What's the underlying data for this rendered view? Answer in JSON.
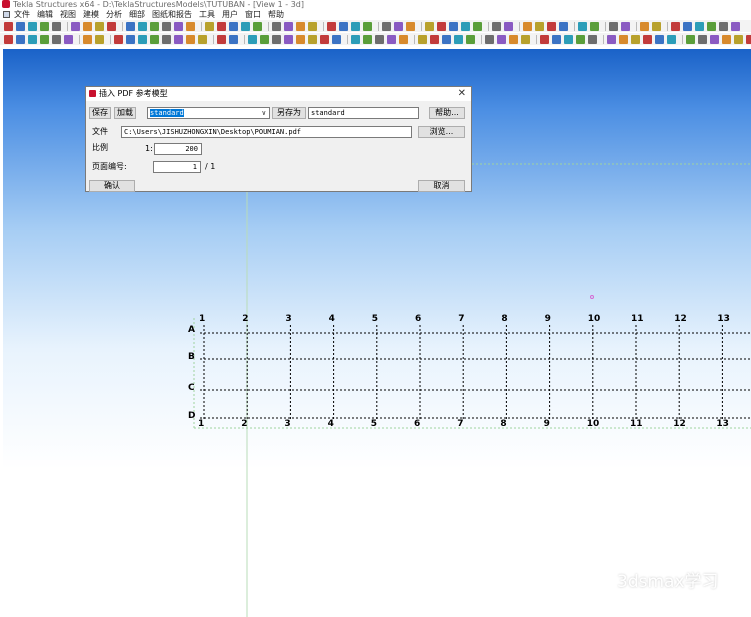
{
  "window": {
    "title": "Tekla Structures x64 - D:\\TeklaStructuresModels\\TUTUBAN - [View 1 - 3d]"
  },
  "menu": [
    "文件",
    "编辑",
    "视图",
    "建模",
    "分析",
    "细部",
    "图纸和报告",
    "工具",
    "用户",
    "窗口",
    "帮助"
  ],
  "dialog": {
    "title": "插入 PDF 参考模型",
    "save_label": "保存",
    "load_label": "加载",
    "preset_value": "standard",
    "save_as_label": "另存为",
    "save_as_value": "standard",
    "help_label": "帮助...",
    "file_label": "文件",
    "file_value": "C:\\Users\\JISHUZHONGXIN\\Desktop\\POUMIAN.pdf",
    "browse_label": "浏览...",
    "scale_label": "比例",
    "scale_prefix": "1:",
    "scale_value": "200",
    "page_label": "页面编号:",
    "page_value": "1",
    "page_total": "/ 1",
    "ok_label": "确认",
    "cancel_label": "取消"
  },
  "grid": {
    "columns": [
      "1",
      "2",
      "3",
      "4",
      "5",
      "6",
      "7",
      "8",
      "9",
      "10",
      "11",
      "12",
      "13"
    ],
    "rows": [
      "A",
      "B",
      "C",
      "D"
    ]
  },
  "watermark": "3dsmax学习",
  "colors": {
    "viewport_top": "#1a62c8",
    "viewport_bottom": "#ffffff",
    "dialog_bg": "#f0f0f0",
    "selection": "#0078d7",
    "grid_line": "#000000",
    "work_area": "#7ec97e"
  }
}
